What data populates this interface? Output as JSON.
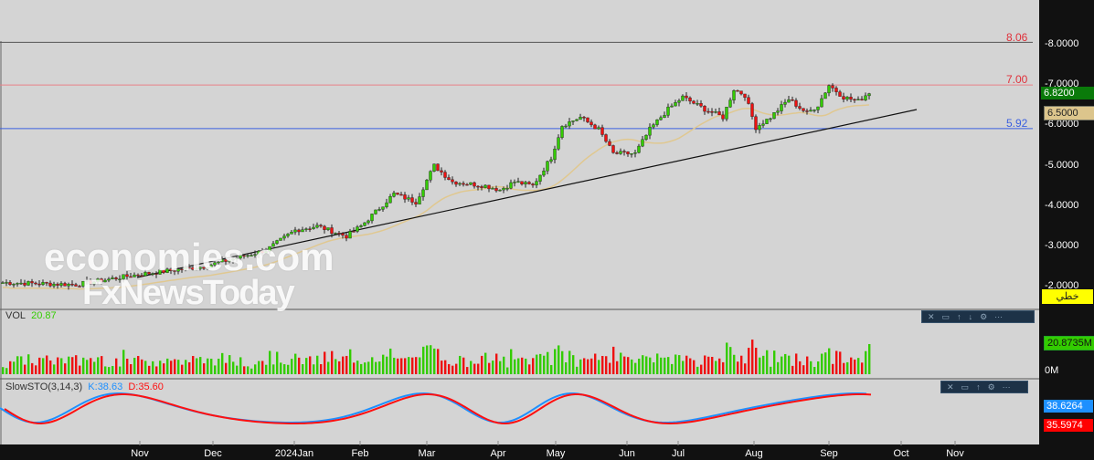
{
  "chart_data": {
    "type": "candlestick",
    "price_axis": {
      "ticks": [
        "8.0000",
        "7.0000",
        "6.0000",
        "5.0000",
        "4.0000",
        "3.0000",
        "2.0000"
      ],
      "range": [
        1.7,
        8.9
      ]
    },
    "time_axis": {
      "ticks": [
        "Nov",
        "Dec",
        "2024Jan",
        "Feb",
        "Mar",
        "Apr",
        "May",
        "Jun",
        "Jul",
        "Aug",
        "Sep",
        "Oct",
        "Nov"
      ]
    },
    "price_path": [
      [
        0,
        2.1
      ],
      [
        20,
        2.05
      ],
      [
        37,
        2.3
      ],
      [
        55,
        2.5
      ],
      [
        72,
        2.9
      ],
      [
        80,
        3.4
      ],
      [
        86,
        3.5
      ],
      [
        94,
        3.25
      ],
      [
        98,
        3.5
      ],
      [
        107,
        4.3
      ],
      [
        113,
        4.1
      ],
      [
        118,
        5.0
      ],
      [
        123,
        4.6
      ],
      [
        132,
        4.5
      ],
      [
        136,
        4.4
      ],
      [
        140,
        4.6
      ],
      [
        145,
        4.5
      ],
      [
        150,
        5.2
      ],
      [
        153,
        6.0
      ],
      [
        158,
        6.2
      ],
      [
        163,
        5.9
      ],
      [
        167,
        5.3
      ],
      [
        173,
        5.3
      ],
      [
        177,
        5.9
      ],
      [
        182,
        6.4
      ],
      [
        186,
        6.7
      ],
      [
        192,
        6.4
      ],
      [
        197,
        6.2
      ],
      [
        200,
        6.9
      ],
      [
        203,
        6.75
      ],
      [
        206,
        5.95
      ],
      [
        210,
        6.2
      ],
      [
        215,
        6.65
      ],
      [
        220,
        6.3
      ],
      [
        223,
        6.5
      ],
      [
        226,
        7.0
      ],
      [
        230,
        6.7
      ],
      [
        234,
        6.6
      ],
      [
        237,
        6.82
      ]
    ],
    "horizontal_levels": [
      {
        "label": "8.06",
        "value": 8.06,
        "color": "#e0303a"
      },
      {
        "label": "7.00",
        "value": 7.0,
        "color": "#e88088"
      },
      {
        "label": "5.92",
        "value": 5.92,
        "color": "#3a5fe0"
      }
    ],
    "last_price": "6.8200",
    "ma_value": "6.5000",
    "indicator_label": "خطي",
    "volume": {
      "label": "VOL",
      "value": "20.87",
      "last": "20.8735M",
      "zero": "0M"
    },
    "stochastic": {
      "label": "SlowSTO(3,14,3)",
      "k_label": "K:38.63",
      "d_label": "D:35.60",
      "k_value": "38.6264",
      "d_value": "35.5974"
    },
    "colors": {
      "up": "#33cc00",
      "down": "#ee1111",
      "ma": "#e0c890",
      "k": "#1e90ff",
      "d": "#ff1010"
    }
  },
  "watermark": {
    "line1": "economies.com",
    "line2": "FxNewsToday"
  },
  "toolbar_icons": [
    "close-icon",
    "maximize-icon",
    "arrow-up-icon",
    "arrow-down-icon",
    "settings-icon",
    "more-icon"
  ]
}
